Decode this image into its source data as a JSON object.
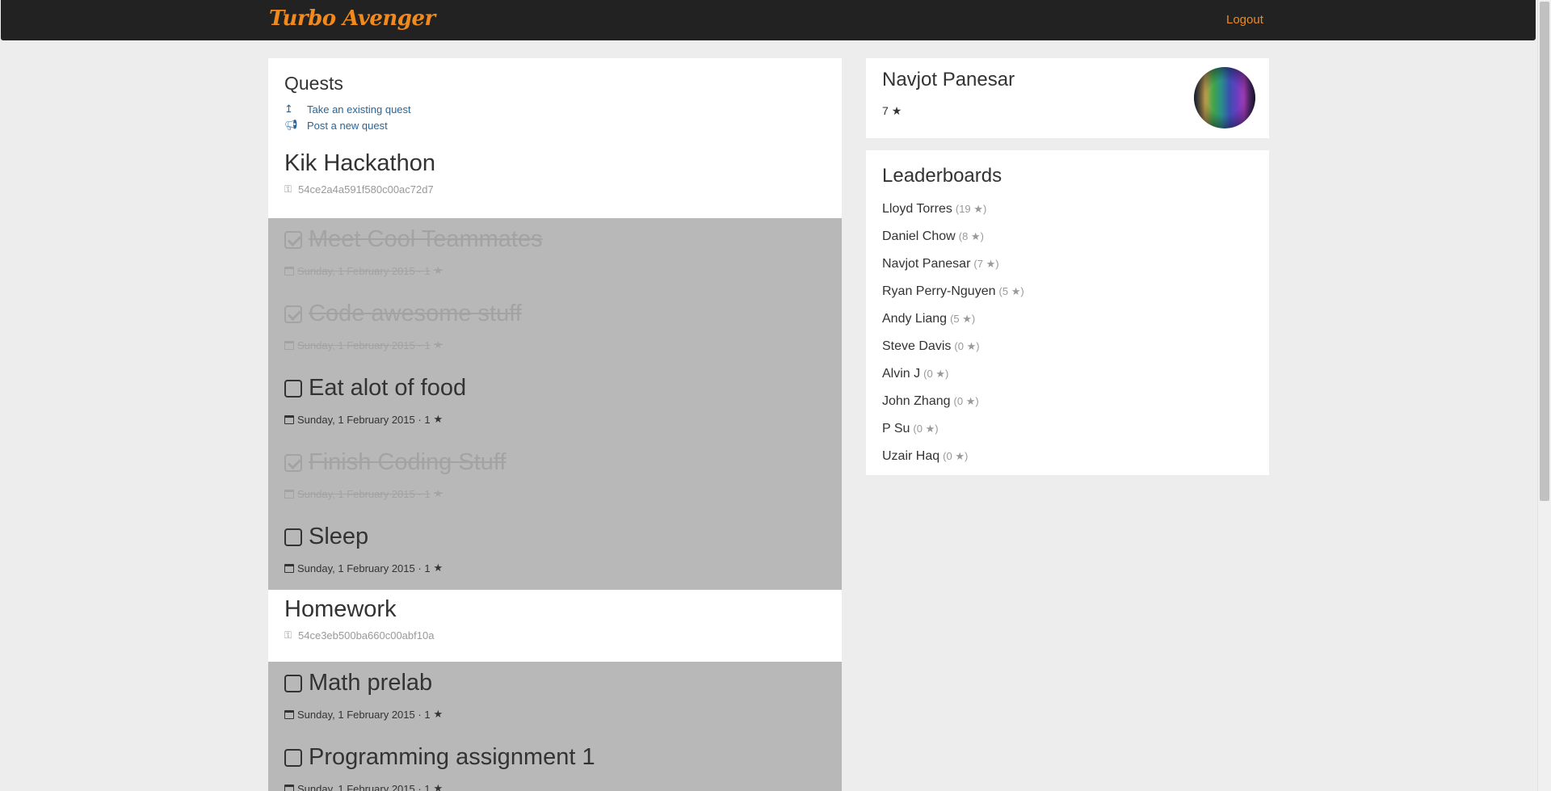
{
  "header": {
    "brand": "Turbo Avenger",
    "logout": "Logout"
  },
  "quests": {
    "title": "Quests",
    "actions": [
      {
        "label": "Take an existing quest",
        "icon": "arrow-up-icon"
      },
      {
        "label": "Post a new quest",
        "icon": "bullhorn-icon"
      }
    ],
    "groups": [
      {
        "name": "Kik Hackathon",
        "key": "54ce2a4a591f580c00ac72d7",
        "tasks": [
          {
            "title": "Meet Cool Teammates",
            "done": true,
            "date": "Sunday, 1 February 2015",
            "points": "1"
          },
          {
            "title": "Code awesome stuff",
            "done": true,
            "date": "Sunday, 1 February 2015",
            "points": "1"
          },
          {
            "title": "Eat alot of food",
            "done": false,
            "date": "Sunday, 1 February 2015",
            "points": "1"
          },
          {
            "title": "Finish Coding Stuff",
            "done": true,
            "date": "Sunday, 1 February 2015",
            "points": "1"
          },
          {
            "title": "Sleep",
            "done": false,
            "date": "Sunday, 1 February 2015",
            "points": "1"
          }
        ]
      },
      {
        "name": "Homework",
        "key": "54ce3eb500ba660c00abf10a",
        "tasks": [
          {
            "title": "Math prelab",
            "done": false,
            "date": "Sunday, 1 February 2015",
            "points": "1"
          },
          {
            "title": "Programming assignment 1",
            "done": false,
            "date": "Sunday, 1 February 2015",
            "points": "1"
          }
        ]
      }
    ]
  },
  "profile": {
    "name": "Navjot Panesar",
    "stars": "7"
  },
  "leaderboards": {
    "title": "Leaderboards",
    "rows": [
      {
        "name": "Lloyd Torres",
        "score": "19"
      },
      {
        "name": "Daniel Chow",
        "score": "8"
      },
      {
        "name": "Navjot Panesar",
        "score": "7"
      },
      {
        "name": "Ryan Perry-Nguyen",
        "score": "5"
      },
      {
        "name": "Andy Liang",
        "score": "5"
      },
      {
        "name": "Steve Davis",
        "score": "0"
      },
      {
        "name": "Alvin J",
        "score": "0"
      },
      {
        "name": "John Zhang",
        "score": "0"
      },
      {
        "name": "P Su",
        "score": "0"
      },
      {
        "name": "Uzair Haq",
        "score": "0"
      }
    ]
  },
  "colors": {
    "brand": "#f08a1d",
    "navbar": "#222222",
    "link": "#2a6496",
    "task_bg": "#b8b8b8"
  }
}
